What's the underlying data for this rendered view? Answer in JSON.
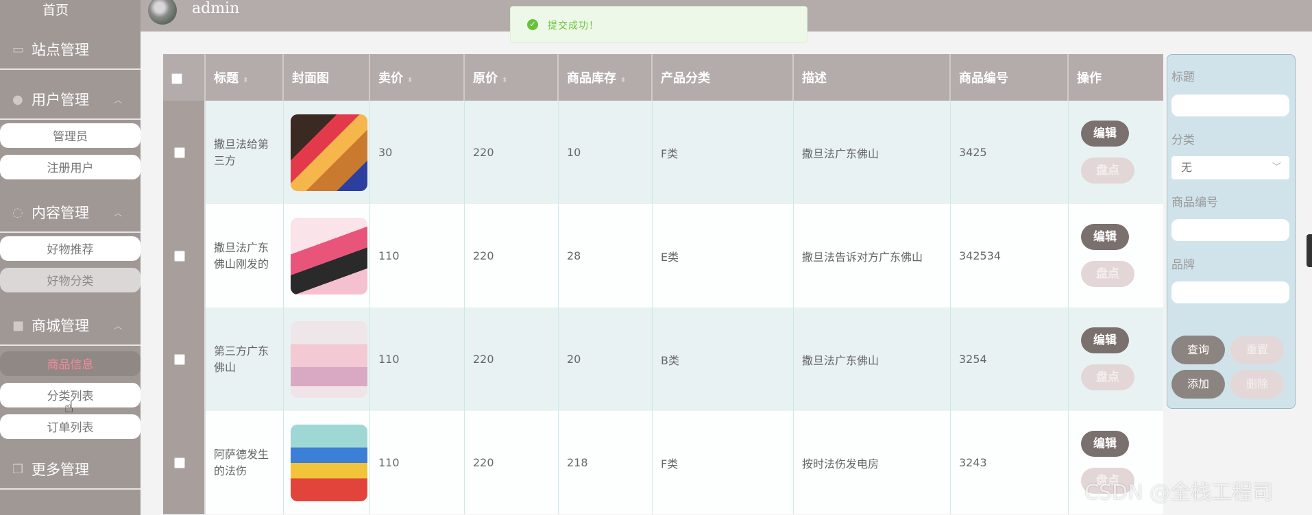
{
  "sidebar": {
    "home": "首页",
    "groups": [
      {
        "label": "站点管理",
        "icon": "monitor-icon"
      },
      {
        "label": "用户管理",
        "icon": "user-icon"
      },
      {
        "label": "内容管理",
        "icon": "chat-icon"
      },
      {
        "label": "商城管理",
        "icon": "lock-icon"
      },
      {
        "label": "更多管理",
        "icon": "copy-icon"
      }
    ],
    "subs": {
      "admin": "管理员",
      "users": "注册用户",
      "recommend": "好物推荐",
      "good_category": "好物分类",
      "product_info": "商品信息",
      "category_list": "分类列表",
      "order_list": "订单列表"
    }
  },
  "header": {
    "username": "admin"
  },
  "toast": {
    "text": "提交成功！"
  },
  "table": {
    "headers": [
      "标题",
      "封面图",
      "卖价",
      "原价",
      "商品库存",
      "产品分类",
      "描述",
      "商品编号",
      "操作"
    ],
    "edit_label": "编辑",
    "check_label": "盘点",
    "rows": [
      {
        "title": "撒旦法给第三方",
        "price": "30",
        "orig": "220",
        "stock": "10",
        "cat": "F类",
        "desc": "撒旦法广东佛山",
        "sku": "3425"
      },
      {
        "title": "撒旦法广东佛山刚发的",
        "price": "110",
        "orig": "220",
        "stock": "28",
        "cat": "E类",
        "desc": "撒旦法告诉对方广东佛山",
        "sku": "342534"
      },
      {
        "title": "第三方广东佛山",
        "price": "110",
        "orig": "220",
        "stock": "20",
        "cat": "B类",
        "desc": "撒旦法广东佛山",
        "sku": "3254"
      },
      {
        "title": "阿萨德发生的法伤",
        "price": "110",
        "orig": "220",
        "stock": "218",
        "cat": "F类",
        "desc": "按时法伤发电房",
        "sku": "3243"
      }
    ]
  },
  "panel": {
    "title_label": "标题",
    "category_label": "分类",
    "category_value": "无",
    "sku_label": "商品编号",
    "brand_label": "品牌",
    "query": "查询",
    "reset": "重置",
    "add": "添加",
    "delete": "删除"
  },
  "watermark": "CSDN @全栈工程司"
}
